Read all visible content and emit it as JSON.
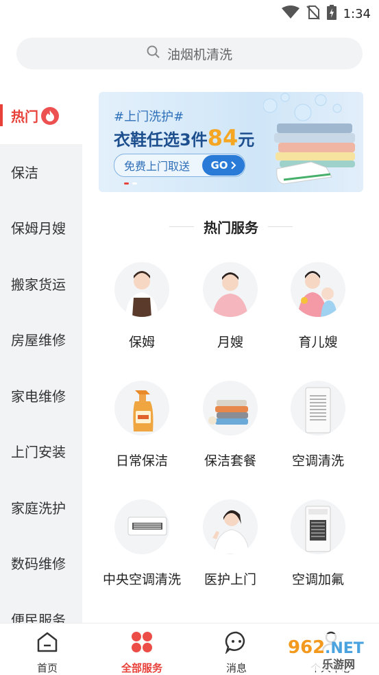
{
  "status_bar": {
    "time": "1:34",
    "icons": [
      "wifi-icon",
      "no-sim-icon",
      "battery-charging-icon"
    ]
  },
  "search": {
    "placeholder": "油烟机清洗"
  },
  "sidebar": {
    "items": [
      {
        "label": "热门",
        "active": true,
        "badge": "fire-icon"
      },
      {
        "label": "保洁"
      },
      {
        "label": "保姆月嫂"
      },
      {
        "label": "搬家货运"
      },
      {
        "label": "房屋维修"
      },
      {
        "label": "家电维修"
      },
      {
        "label": "上门安装"
      },
      {
        "label": "家庭洗护"
      },
      {
        "label": "数码维修"
      },
      {
        "label": "便民服务"
      }
    ]
  },
  "banner": {
    "tag": "#上门洗护#",
    "title_prefix": "衣鞋任选3件",
    "title_number": "84",
    "title_suffix": "元",
    "cta": "免费上门取送",
    "go": "GO"
  },
  "section": {
    "title": "热门服务"
  },
  "services": [
    {
      "label": "保姆",
      "icon": "nanny-avatar-icon"
    },
    {
      "label": "月嫂",
      "icon": "maternity-nurse-avatar-icon"
    },
    {
      "label": "育儿嫂",
      "icon": "childcare-avatar-icon"
    },
    {
      "label": "日常保洁",
      "icon": "spray-bottle-icon"
    },
    {
      "label": "保洁套餐",
      "icon": "towel-stack-icon"
    },
    {
      "label": "空调清洗",
      "icon": "standing-ac-icon"
    },
    {
      "label": "中央空调清洗",
      "icon": "central-ac-icon"
    },
    {
      "label": "医护上门",
      "icon": "nurse-avatar-icon"
    },
    {
      "label": "空调加氟",
      "icon": "ac-refrigerant-icon"
    }
  ],
  "tabbar": {
    "items": [
      {
        "label": "首页",
        "icon": "home-icon"
      },
      {
        "label": "全部服务",
        "icon": "all-services-icon",
        "active": true
      },
      {
        "label": "消息",
        "icon": "message-icon"
      },
      {
        "label": "个人中心",
        "icon": "profile-icon"
      }
    ]
  },
  "watermark": {
    "text_top": "962",
    "text_top_suffix": ".NET",
    "text_bottom": "乐游网"
  },
  "colors": {
    "accent": "#e8413a",
    "banner_blue": "#2a7bd8",
    "sidebar_bg": "#f2f3f5"
  }
}
